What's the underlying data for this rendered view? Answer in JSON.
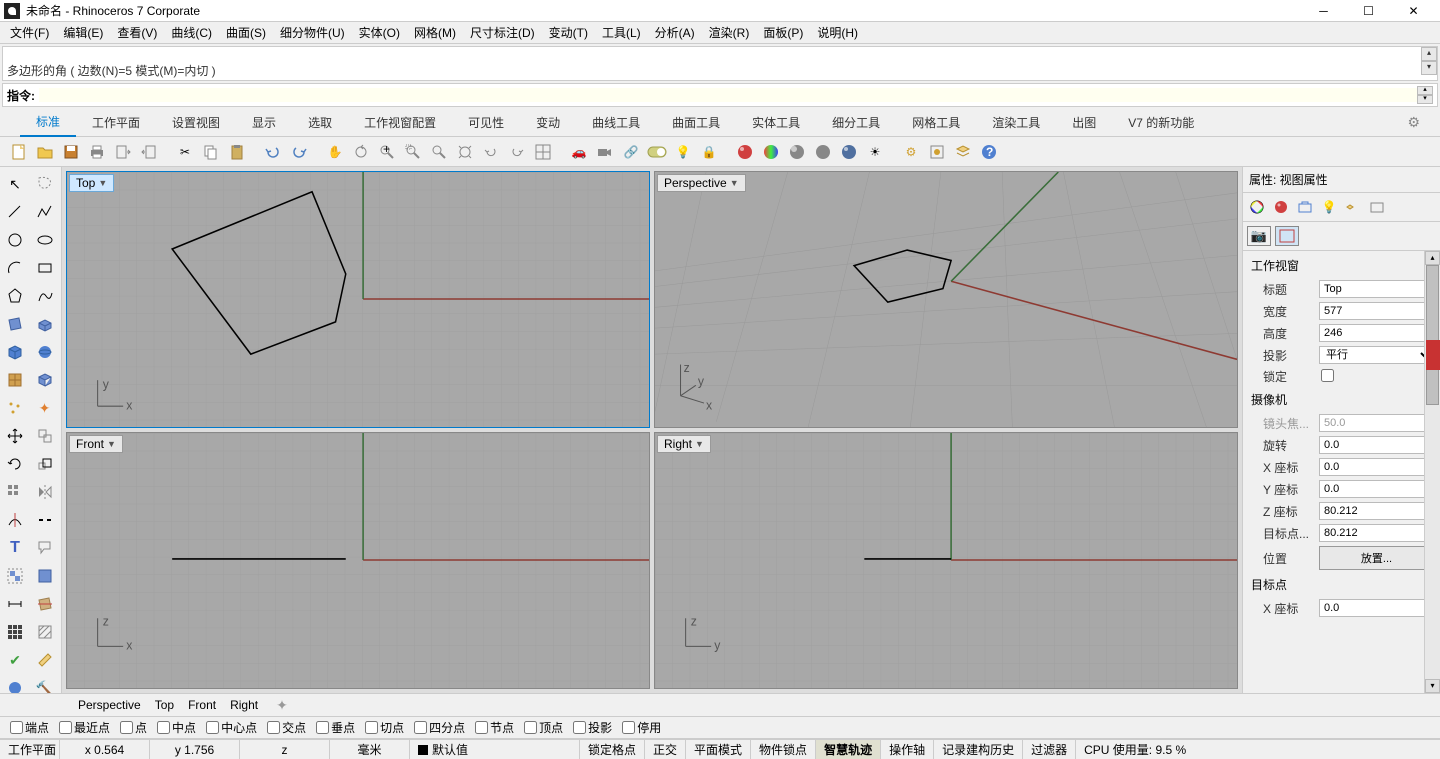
{
  "window": {
    "title": "未命名 - Rhinoceros 7 Corporate"
  },
  "menu": [
    "文件(F)",
    "编辑(E)",
    "查看(V)",
    "曲线(C)",
    "曲面(S)",
    "细分物件(U)",
    "实体(O)",
    "网格(M)",
    "尺寸标注(D)",
    "变动(T)",
    "工具(L)",
    "分析(A)",
    "渲染(R)",
    "面板(P)",
    "说明(H)"
  ],
  "cmd_history": {
    "line1": "...",
    "line2": "多边形的角 ( 边数(N)=5  模式(M)=内切 )"
  },
  "cmd_prompt": {
    "label": "指令:",
    "value": ""
  },
  "ribbon_tabs": [
    "标准",
    "工作平面",
    "设置视图",
    "显示",
    "选取",
    "工作视窗配置",
    "可见性",
    "变动",
    "曲线工具",
    "曲面工具",
    "实体工具",
    "细分工具",
    "网格工具",
    "渲染工具",
    "出图",
    "V7 的新功能"
  ],
  "viewports": {
    "top": "Top",
    "perspective": "Perspective",
    "front": "Front",
    "right": "Right"
  },
  "props": {
    "header": "属性: 视图属性",
    "section1": "工作视窗",
    "title_label": "标题",
    "title_value": "Top",
    "width_label": "宽度",
    "width_value": "577",
    "height_label": "高度",
    "height_value": "246",
    "projection_label": "投影",
    "projection_value": "平行",
    "lock_label": "锁定",
    "section2": "摄像机",
    "lens_label": "镜头焦...",
    "lens_value": "50.0",
    "rotation_label": "旋转",
    "rotation_value": "0.0",
    "x_label": "X 座标",
    "x_value": "0.0",
    "y_label": "Y 座标",
    "y_value": "0.0",
    "z_label": "Z 座标",
    "z_value": "80.212",
    "target_dist_label": "目标点...",
    "target_dist_value": "80.212",
    "position_label": "位置",
    "position_btn": "放置...",
    "section3": "目标点",
    "tx_label": "X 座标",
    "tx_value": "0.0"
  },
  "vp_tab_bar": [
    "Perspective",
    "Top",
    "Front",
    "Right"
  ],
  "osnap": [
    "端点",
    "最近点",
    "点",
    "中点",
    "中心点",
    "交点",
    "垂点",
    "切点",
    "四分点",
    "节点",
    "顶点",
    "投影",
    "停用"
  ],
  "status": {
    "cplane": "工作平面",
    "x": "x 0.564",
    "y": "y 1.756",
    "z": "z",
    "units": "毫米",
    "layer": "默认值",
    "gridsnap": "锁定格点",
    "ortho": "正交",
    "planar": "平面模式",
    "objsnap": "物件锁点",
    "smarttrack": "智慧轨迹",
    "gumball": "操作轴",
    "record": "记录建构历史",
    "filter": "过滤器",
    "cpu": "CPU 使用量: 9.5 %"
  }
}
